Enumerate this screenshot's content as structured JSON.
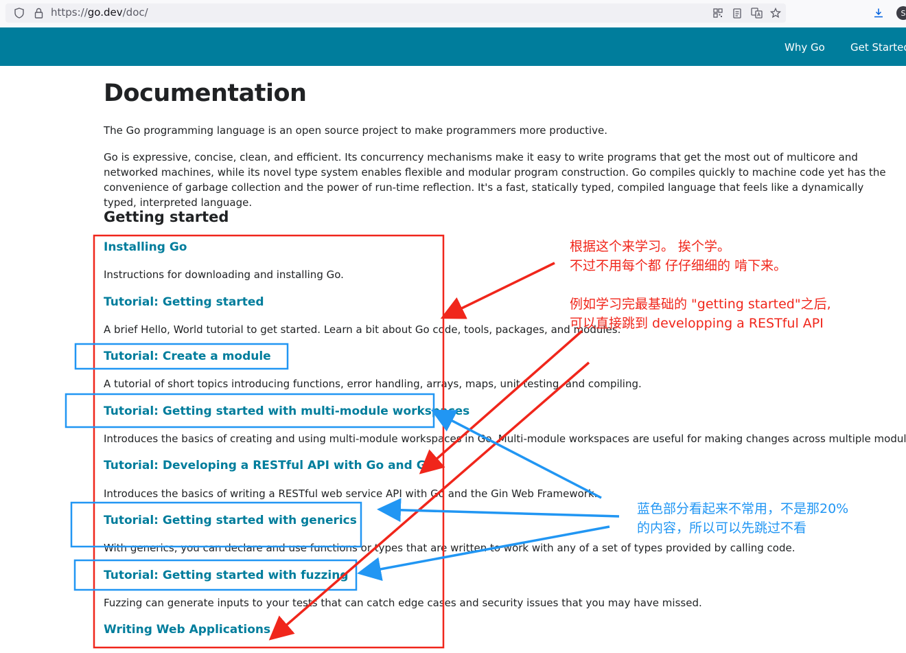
{
  "browser": {
    "url_prefix": "https://",
    "url_host": "go.dev",
    "url_path": "/doc/",
    "avatar_letter": "S"
  },
  "nav": {
    "why_go": "Why Go",
    "get_started": "Get Started"
  },
  "page": {
    "title": "Documentation",
    "intro": "The Go programming language is an open source project to make programmers more productive.",
    "description": "Go is expressive, concise, clean, and efficient. Its concurrency mechanisms make it easy to write programs that get the most out of multicore and networked machines, while its novel type system enables flexible and modular program construction. Go compiles quickly to machine code yet has the convenience of garbage collection and the power of run-time reflection. It's a fast, statically typed, compiled language that feels like a dynamically typed, interpreted language.",
    "section_title": "Getting started"
  },
  "entries": [
    {
      "title": "Installing Go",
      "desc": "Instructions for downloading and installing Go."
    },
    {
      "title": "Tutorial: Getting started",
      "desc": "A brief Hello, World tutorial to get started. Learn a bit about Go code, tools, packages, and modules."
    },
    {
      "title": "Tutorial: Create a module",
      "desc": "A tutorial of short topics introducing functions, error handling, arrays, maps, unit testing, and compiling."
    },
    {
      "title": "Tutorial: Getting started with multi-module workspaces",
      "desc": "Introduces the basics of creating and using multi-module workspaces in Go. Multi-module workspaces are useful for making changes across multiple modules."
    },
    {
      "title": "Tutorial: Developing a RESTful API with Go and Gin",
      "desc": "Introduces the basics of writing a RESTful web service API with Go and the Gin Web Framework."
    },
    {
      "title": "Tutorial: Getting started with generics",
      "desc": "With generics, you can declare and use functions or types that are written to work with any of a set of types provided by calling code."
    },
    {
      "title": "Tutorial: Getting started with fuzzing",
      "desc": "Fuzzing can generate inputs to your tests that can catch edge cases and security issues that you may have missed."
    },
    {
      "title": "Writing Web Applications"
    }
  ],
  "annotations": {
    "red_note_1_line1": "根据这个来学习。 挨个学。",
    "red_note_1_line2": "不过不用每个都 仔仔细细的 啃下来。",
    "red_note_2_line1": "例如学习完最基础的 \"getting started\"之后,",
    "red_note_2_line2": "可以直接跳到 developping a RESTful API",
    "blue_note_line1": "蓝色部分看起来不常用，不是那20%",
    "blue_note_line2": "的内容，所以可以先跳过不看",
    "red_color": "#f0261b",
    "blue_color": "#2196f3"
  }
}
